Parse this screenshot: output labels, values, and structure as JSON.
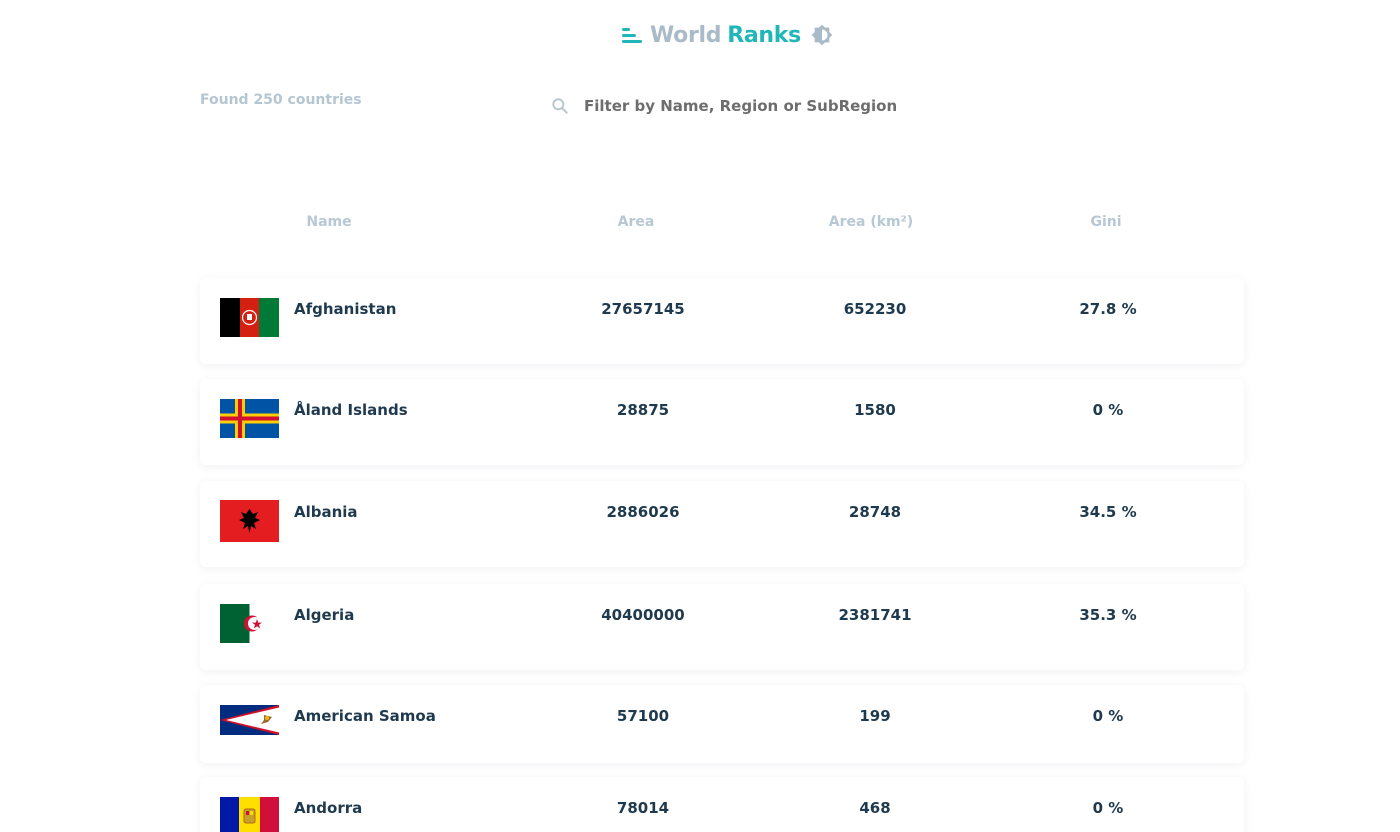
{
  "header": {
    "logo_word1": "World",
    "logo_word2": "Ranks",
    "logo_icon": "bars-icon",
    "theme_icon": "sun-toggle-icon"
  },
  "found_text": "Found 250 countries",
  "search": {
    "placeholder": "Filter by Name, Region or SubRegion",
    "value": ""
  },
  "table": {
    "headers": [
      "Name",
      "Area",
      "Area (km²)",
      "Gini"
    ],
    "rows": [
      {
        "name": "Afghanistan",
        "col2": "27657145",
        "area": "652230",
        "gini": "27.8 %",
        "flag": "afghanistan"
      },
      {
        "name": "Åland Islands",
        "col2": "28875",
        "area": "1580",
        "gini": "0 %",
        "flag": "aland"
      },
      {
        "name": "Albania",
        "col2": "2886026",
        "area": "28748",
        "gini": "34.5 %",
        "flag": "albania"
      },
      {
        "name": "Algeria",
        "col2": "40400000",
        "area": "2381741",
        "gini": "35.3 %",
        "flag": "algeria"
      },
      {
        "name": "American Samoa",
        "col2": "57100",
        "area": "199",
        "gini": "0 %",
        "flag": "american-samoa"
      },
      {
        "name": "Andorra",
        "col2": "78014",
        "area": "468",
        "gini": "0 %",
        "flag": "andorra"
      }
    ]
  },
  "colors": {
    "accent": "#21b6b7",
    "muted": "#a9bbc8",
    "text": "#1f3a4e"
  }
}
